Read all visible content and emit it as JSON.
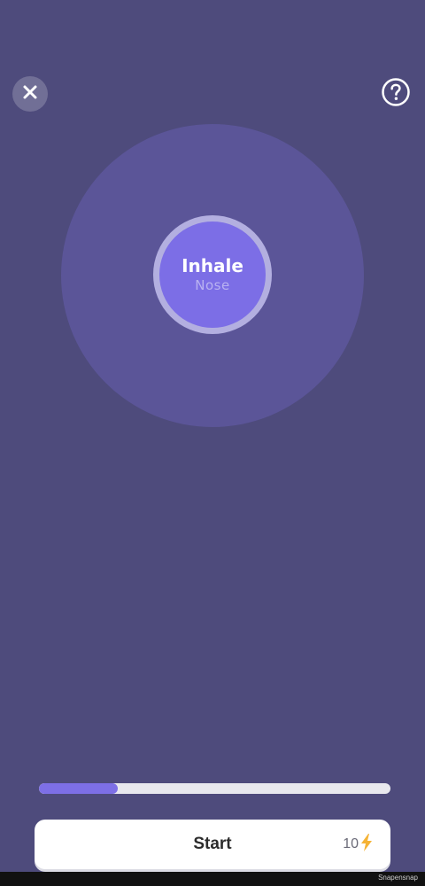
{
  "header": {
    "close_icon": "close-icon",
    "help_icon": "question-mark-icon"
  },
  "breath": {
    "phase": "Inhale",
    "method": "Nose"
  },
  "progress": {
    "value_fraction": 0.225
  },
  "start_button": {
    "label": "Start",
    "cost": "10",
    "cost_icon": "lightning-bolt-icon"
  },
  "footer": {
    "watermark": "Snapensnap"
  },
  "colors": {
    "background": "#4e4b7c",
    "outer_circle": "#5b5598",
    "inner_circle": "#7c6ee6",
    "progress_fill": "#7d6fe6",
    "bolt": "#f5b335"
  }
}
